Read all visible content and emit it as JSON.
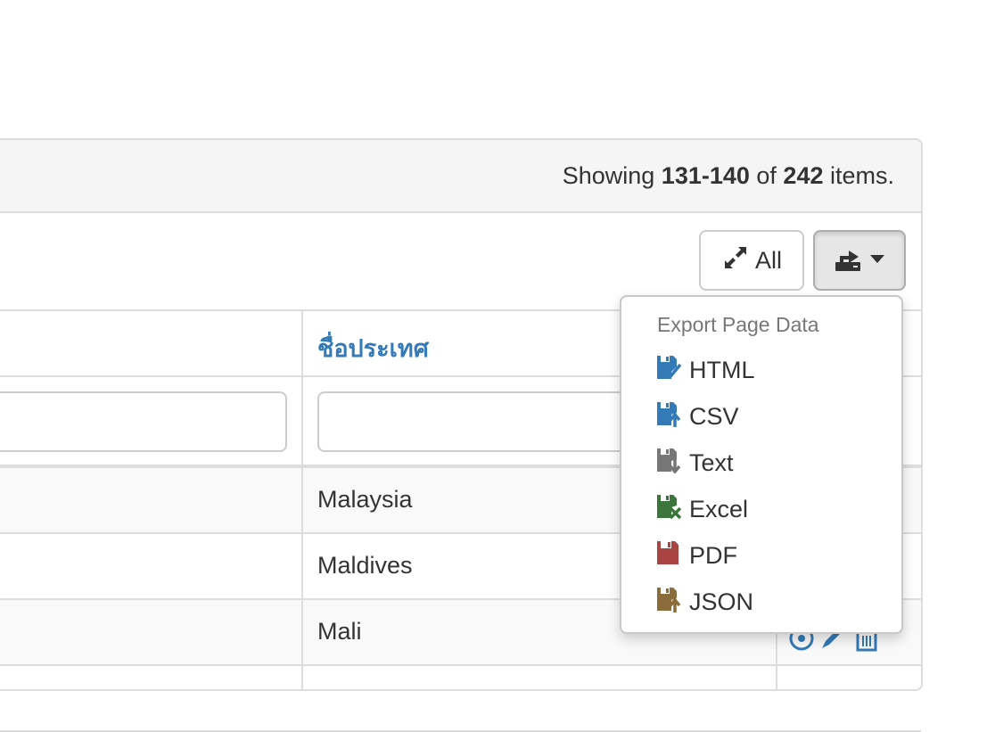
{
  "summary": {
    "prefix": "Showing ",
    "range": "131-140",
    "middle": " of ",
    "total": "242",
    "suffix": " items."
  },
  "toolbar": {
    "toggle_all_label": "All",
    "export_icon": "export-icon",
    "caret_icon": "caret-down-icon"
  },
  "table": {
    "column_header": "ชื่อประเทศ",
    "rows": [
      {
        "country": "Malaysia"
      },
      {
        "country": "Maldives"
      },
      {
        "country": "Mali"
      }
    ]
  },
  "export_menu": {
    "header": "Export Page Data",
    "items": [
      {
        "label": "HTML",
        "icon": "html-file-icon",
        "color": "#337ab7"
      },
      {
        "label": "CSV",
        "icon": "csv-file-icon",
        "color": "#337ab7"
      },
      {
        "label": "Text",
        "icon": "text-file-icon",
        "color": "#777777"
      },
      {
        "label": "Excel",
        "icon": "excel-file-icon",
        "color": "#3c763d"
      },
      {
        "label": "PDF",
        "icon": "pdf-file-icon",
        "color": "#a94442"
      },
      {
        "label": "JSON",
        "icon": "json-file-icon",
        "color": "#8a6d3b"
      }
    ]
  },
  "colors": {
    "link": "#337ab7",
    "border": "#dddddd",
    "summary_bg": "#f5f5f5"
  }
}
